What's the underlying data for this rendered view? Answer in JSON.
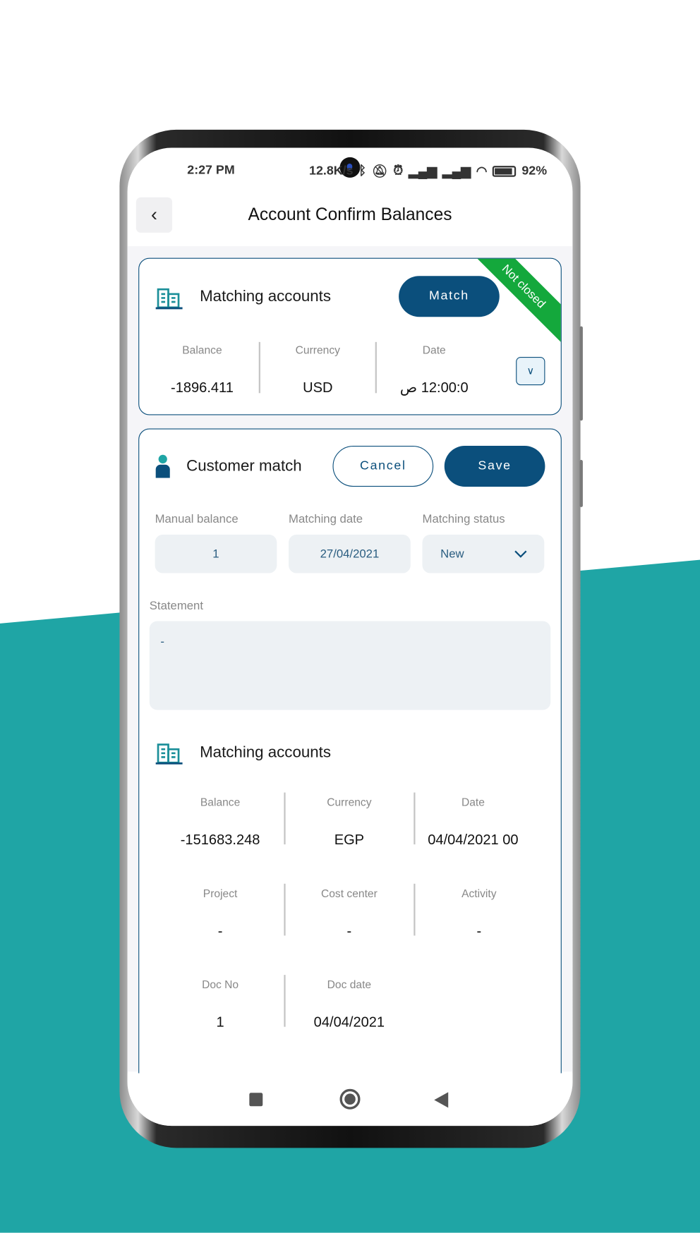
{
  "colors": {
    "primary": "#0b4f7c",
    "ribbon": "#14a83c",
    "background_accent": "#1fa5a5"
  },
  "status_bar": {
    "time": "2:27 PM",
    "net_speed": "12.8K/s",
    "battery": "92%",
    "icons": [
      "bluetooth-icon",
      "bell-off-icon",
      "alarm-icon",
      "signal-icon",
      "signal-icon",
      "wifi-icon",
      "battery-icon"
    ]
  },
  "header": {
    "title": "Account Confirm Balances",
    "back_icon": "chevron-left-icon"
  },
  "summary_card": {
    "title": "Matching accounts",
    "match_label": "Match",
    "ribbon": "Not closed",
    "fields": [
      {
        "label": "Balance",
        "value": "-1896.411"
      },
      {
        "label": "Currency",
        "value": "USD"
      },
      {
        "label": "Date",
        "value": "12:00:0 ص"
      }
    ]
  },
  "customer_match": {
    "title": "Customer match",
    "cancel_label": "Cancel",
    "save_label": "Save",
    "manual_balance": {
      "label": "Manual balance",
      "value": "1"
    },
    "matching_date": {
      "label": "Matching date",
      "value": "27/04/2021"
    },
    "matching_status": {
      "label": "Matching status",
      "value": "New"
    },
    "statement": {
      "label": "Statement",
      "value": "-"
    },
    "matching_title": "Matching accounts",
    "fields": [
      {
        "label": "Balance",
        "value": "-151683.248"
      },
      {
        "label": "Currency",
        "value": "EGP"
      },
      {
        "label": "Date",
        "value": "00 04/04/2021"
      },
      {
        "label": "Project",
        "value": "-"
      },
      {
        "label": "Cost center",
        "value": "-"
      },
      {
        "label": "Activity",
        "value": "-"
      },
      {
        "label": "Doc No",
        "value": "1"
      },
      {
        "label": "Doc date",
        "value": "04/04/2021"
      }
    ]
  }
}
